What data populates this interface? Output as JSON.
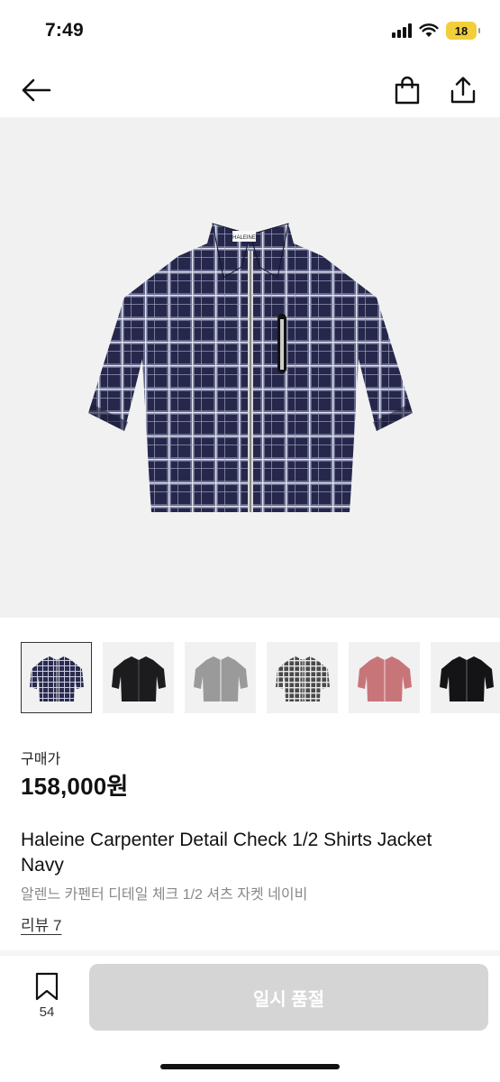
{
  "status_bar": {
    "time": "7:49",
    "battery": "18",
    "battery_color": "#f2cf3a"
  },
  "nav": {
    "back_icon": "arrow-left-icon",
    "bag_icon": "shopping-bag-icon",
    "share_icon": "share-icon"
  },
  "product": {
    "image_label": "HALEINE",
    "thumbnails": [
      {
        "color": "navy-check",
        "selected": true
      },
      {
        "color": "black"
      },
      {
        "color": "grey"
      },
      {
        "color": "grey-check"
      },
      {
        "color": "pink"
      },
      {
        "color": "black"
      }
    ],
    "price_label": "구매가",
    "price": "158,000원",
    "title": "Haleine Carpenter Detail Check 1/2 Shirts Jacket Navy",
    "subtitle": "알렌느 카펜터 디테일 체크 1/2 셔츠 자켓 네이비",
    "review_link": "리뷰 7"
  },
  "bottom_bar": {
    "bookmark_count": "54",
    "soldout_label": "일시 품절",
    "soldout_color": "#d5d5d5"
  }
}
